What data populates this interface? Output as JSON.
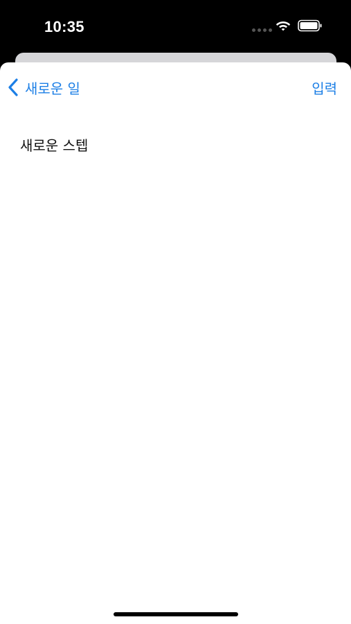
{
  "status_bar": {
    "time": "10:35",
    "icons": [
      "signal-dots-icon",
      "wifi-icon",
      "battery-icon"
    ]
  },
  "nav": {
    "back_label": "새로운 일",
    "action_label": "입력",
    "accent_color": "#1c7fe6"
  },
  "content": {
    "step_title": "새로운 스텝"
  }
}
